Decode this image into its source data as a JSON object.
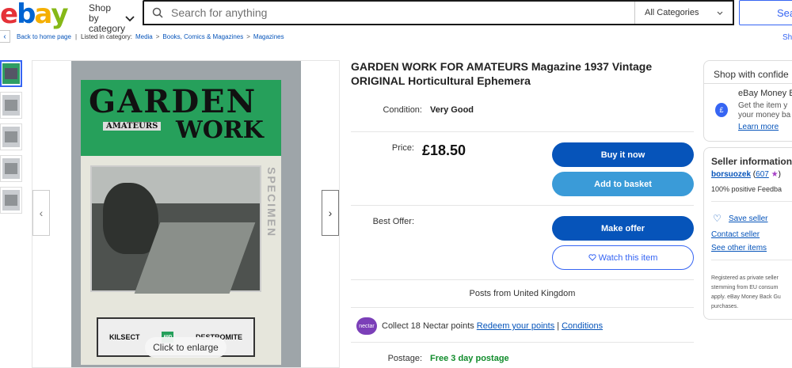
{
  "header": {
    "logo_letters": [
      {
        "ch": "e",
        "color": "#e53238"
      },
      {
        "ch": "b",
        "color": "#0064d2"
      },
      {
        "ch": "a",
        "color": "#f5af02"
      },
      {
        "ch": "y",
        "color": "#86b817"
      }
    ],
    "shop_by_category": "Shop by category",
    "search_placeholder": "Search for anything",
    "category_select": "All Categories",
    "search_button": "Sear"
  },
  "breadcrumb": {
    "back_label": "Back to home page",
    "listed_in": "Listed in category:",
    "items": [
      "Media",
      "Books, Comics & Magazines",
      "Magazines"
    ],
    "share": "Sh"
  },
  "gallery": {
    "enlarge_label": "Click to enlarge",
    "thumb_count": 5
  },
  "listing": {
    "title": "GARDEN WORK FOR AMATEURS Magazine 1937 Vintage ORIGINAL Horticultural Ephemera",
    "condition_label": "Condition:",
    "condition_value": "Very Good",
    "price_label": "Price:",
    "price_value": "£18.50",
    "buy_now": "Buy it now",
    "add_to_basket": "Add to basket",
    "best_offer_label": "Best Offer:",
    "make_offer": "Make offer",
    "watch": "Watch this item",
    "posts_from": "Posts from United Kingdom",
    "nectar_badge": "nectar",
    "nectar_text": "Collect 18 Nectar points",
    "nectar_redeem": "Redeem your points",
    "nectar_sep": "|",
    "nectar_conditions": "Conditions",
    "postage_label": "Postage:",
    "postage_value": "Free 3 day postage"
  },
  "sidebar": {
    "shop_confidence": "Shop with confide",
    "money_back_title": "eBay Money B",
    "money_back_desc_1": "Get the item y",
    "money_back_desc_2": "your money ba",
    "learn_more": "Learn more",
    "seller_info": "Seller information",
    "seller_name": "borsuozek",
    "feedback_count": "607",
    "positive": "100% positive Feedba",
    "save_seller": "Save seller",
    "contact_seller": "Contact seller",
    "see_other": "See other items",
    "private_lines": [
      "Registered as private seller",
      "stemming from EU consum",
      "apply. eBay Money Back Gu",
      "purchases."
    ]
  }
}
